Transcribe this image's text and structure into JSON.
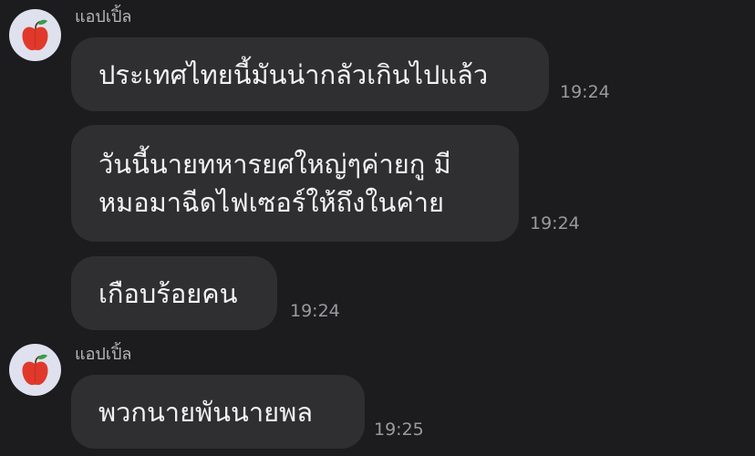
{
  "chat": {
    "messages": [
      {
        "sender": "แอปเปิ้ล",
        "avatar_icon": "red-apple-icon",
        "text": "ประเทศไทยนี้มันน่ากลัวเกินไปแล้ว",
        "time": "19:24"
      },
      {
        "text": "วันนี้นายทหารยศใหญ่ๆค่ายกู มี\nหมอมาฉีดไฟเซอร์ให้ถึงในค่าย",
        "time": "19:24"
      },
      {
        "text": "เกือบร้อยคน",
        "time": "19:24"
      },
      {
        "sender": "แอปเปิ้ล",
        "avatar_icon": "red-apple-icon",
        "text": "พวกนายพันนายพล",
        "time": "19:25"
      }
    ]
  },
  "colors": {
    "background": "#1c1c1e",
    "bubble": "#2f2f32",
    "avatar_bg": "#dfe1ee",
    "apple_red": "#e0392b",
    "leaf_green": "#3a9b4a"
  }
}
